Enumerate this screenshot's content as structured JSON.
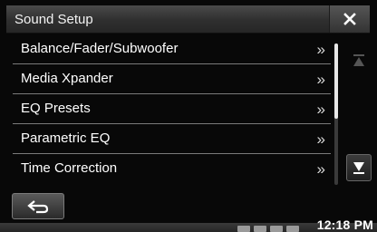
{
  "header": {
    "title": "Sound Setup",
    "close_icon": "close-icon"
  },
  "menu": {
    "items": [
      {
        "label": "Balance/Fader/Subwoofer",
        "chevron": "»"
      },
      {
        "label": "Media Xpander",
        "chevron": "»"
      },
      {
        "label": "EQ Presets",
        "chevron": "»"
      },
      {
        "label": "Parametric EQ",
        "chevron": "»"
      },
      {
        "label": "Time Correction",
        "chevron": "»"
      }
    ]
  },
  "scroll": {
    "up_icon": "scroll-up-arrow-icon",
    "down_icon": "scroll-down-arrow-icon",
    "thumb_fraction": 0.53
  },
  "footer": {
    "back_icon": "back-arrow-icon"
  },
  "status": {
    "time": "12:18 PM",
    "icons": [
      "bluetooth-icon",
      "bluetooth-icon",
      "battery-icon",
      "signal-icon"
    ]
  },
  "colors": {
    "background": "#080808",
    "header": "#3a3a3a",
    "text": "#ffffff",
    "divider": "#7a7a7a"
  }
}
